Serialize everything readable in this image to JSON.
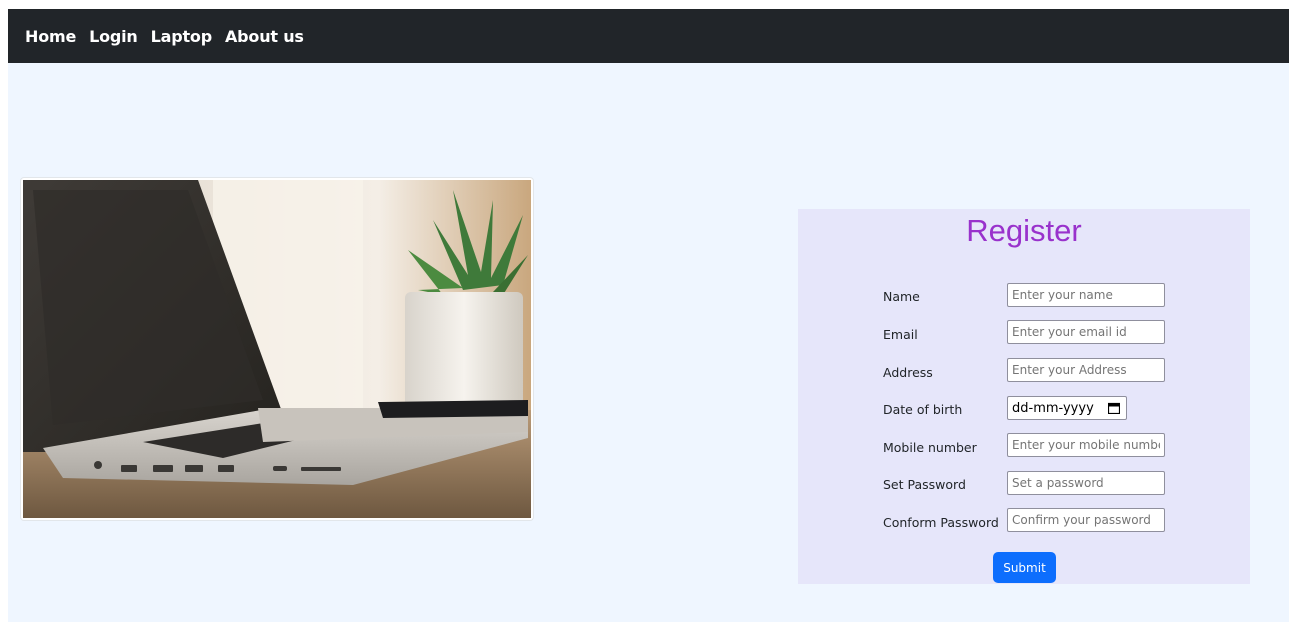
{
  "navbar": {
    "links": [
      "Home",
      "Login",
      "Laptop",
      "About us"
    ]
  },
  "hero": {
    "image_subject": "laptop-with-phone-and-plant-photo"
  },
  "register": {
    "title": "Register",
    "fields": [
      {
        "label": "Name",
        "placeholder": "Enter your name",
        "type": "text"
      },
      {
        "label": "Email",
        "placeholder": "Enter your email id",
        "type": "email"
      },
      {
        "label": "Address",
        "placeholder": "Enter your Address",
        "type": "text"
      },
      {
        "label": "Date of birth",
        "placeholder": "dd-mm-yyyy",
        "type": "date"
      },
      {
        "label": "Mobile number",
        "placeholder": "Enter your mobile number",
        "type": "tel"
      },
      {
        "label": "Set Password",
        "placeholder": "Set a password",
        "type": "password"
      },
      {
        "label": "Conform Password",
        "placeholder": "Confirm your password",
        "type": "password"
      }
    ],
    "submit_label": "Submit"
  },
  "colors": {
    "navbar_bg": "#212529",
    "page_bg": "#eff6ff",
    "panel_bg": "#e6e6fa",
    "title_color": "#9932cc",
    "button_bg": "#0d6efd"
  }
}
